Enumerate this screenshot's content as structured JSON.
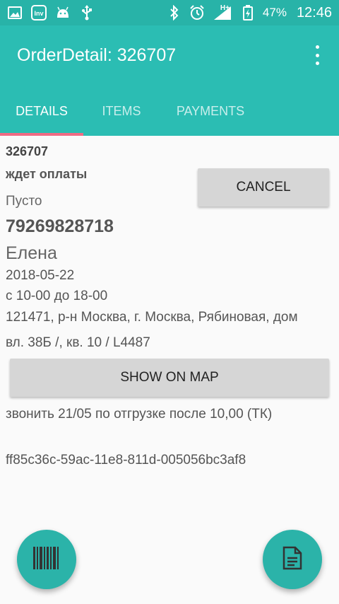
{
  "status_bar": {
    "battery": "47%",
    "time": "12:46",
    "network": "H+",
    "left_icons": [
      "image-icon",
      "inv-app-icon",
      "android-icon",
      "usb-icon"
    ],
    "right_icons": [
      "bluetooth-icon",
      "alarm-icon",
      "signal-icon",
      "battery-icon"
    ]
  },
  "app_bar": {
    "title": "OrderDetail: 326707",
    "tabs": [
      {
        "label": "DETAILS",
        "active": true
      },
      {
        "label": "ITEMS",
        "active": false
      },
      {
        "label": "PAYMENTS",
        "active": false
      }
    ],
    "accent": "#2bbdb3",
    "indicator_color": "#f06b84"
  },
  "order": {
    "id": "326707",
    "status": "ждет оплаты",
    "empty_label": "Пусто",
    "phone": "79269828718",
    "client_name": "Елена",
    "date": "2018-05-22",
    "time_window": "с 10-00 до 18-00",
    "address_line1": "121471, р-н Москва, г. Москва, Рябиновая, дом",
    "address_line2": "вл.  38Б /, кв. 10 / L4487",
    "comment": "звонить 21/05 по отгрузке после 10,00 (ТК)",
    "guid": "ff85c36c-59ac-11e8-811d-005056bc3af8"
  },
  "buttons": {
    "cancel": "CANCEL",
    "show_on_map": "SHOW ON MAP"
  },
  "fabs": {
    "left_icon": "barcode-icon",
    "right_icon": "document-icon"
  }
}
